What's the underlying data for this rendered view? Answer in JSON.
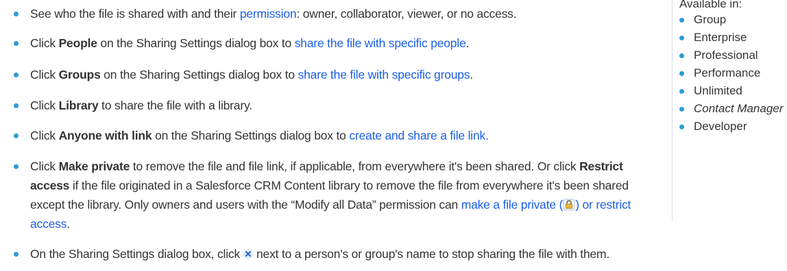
{
  "colors": {
    "link": "#1a5ee6",
    "bullet": "#2b9bd6",
    "text": "#333333"
  },
  "items": [
    {
      "t1": "See who the file is shared with and their ",
      "link1": "permission",
      "t2": ": owner, collaborator, viewer, or no access."
    },
    {
      "t1": "Click ",
      "bold": "People",
      "t2": " on the Sharing Settings dialog box to ",
      "link1": "share the file with specific people",
      "t3": "."
    },
    {
      "t1": "Click ",
      "bold": "Groups",
      "t2": " on the Sharing Settings dialog box to ",
      "link1": "share the file with specific groups",
      "t3": "."
    },
    {
      "t1": "Click ",
      "bold": "Library",
      "t2": " to share the file with a library."
    },
    {
      "t1": "Click ",
      "bold": "Anyone with link",
      "t2": " on the Sharing Settings dialog box to ",
      "link1": "create and share a file link."
    },
    {
      "t1": "Click ",
      "bold": "Make private",
      "t2": " to remove the file and file link, if applicable, from everywhere it's been shared. Or click ",
      "bold2": "Restrict access",
      "t3": " if the file originated in a Salesforce CRM Content library to remove the file from everywhere it's been shared except the library. Only owners and users with the “Modify all Data” permission can ",
      "link1": "make a file private (",
      "link2": ") or restrict access",
      "t4": "."
    },
    {
      "t1": "On the Sharing Settings dialog box, click",
      "t2": "next to a person's or group's name to stop sharing the file with them."
    }
  ],
  "sidebar": {
    "title": "Available in:",
    "editions": [
      "Group",
      "Enterprise",
      "Professional",
      "Performance",
      "Unlimited",
      "Contact Manager",
      "Developer"
    ]
  }
}
